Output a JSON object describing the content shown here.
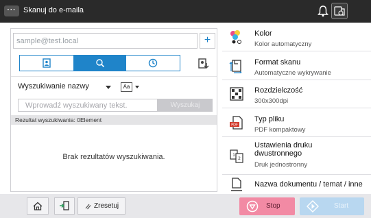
{
  "header": {
    "menu_label": "···",
    "title": "Skanuj do e-maila"
  },
  "address": {
    "placeholder": "sample@test.local"
  },
  "search": {
    "type_label": "Wyszukiwanie nazwy",
    "case_label": "Aa",
    "input_placeholder": "Wprowadź wyszukiwany tekst.",
    "button_label": "Wyszukaj",
    "result_label": "Rezultat wyszukiwania: 0Element",
    "empty_label": "Brak rezultatów wyszukiwania."
  },
  "settings": [
    {
      "title": "Kolor",
      "value": "Kolor automatyczny",
      "icon": "color-icon"
    },
    {
      "title": "Format skanu",
      "value": "Automatyczne wykrywanie",
      "icon": "scan-format-icon"
    },
    {
      "title": "Rozdzielczość",
      "value": "300x300dpi",
      "icon": "resolution-icon"
    },
    {
      "title": "Typ pliku",
      "value": "PDF kompaktowy",
      "icon": "pdf-file-icon"
    },
    {
      "title_line1": "Ustawienia druku",
      "title_line2": "dwustronnego",
      "value": "Druk jednostronny",
      "icon": "duplex-icon"
    },
    {
      "title": "Nazwa dokumentu / temat / inne",
      "icon": "document-name-icon"
    }
  ],
  "footer": {
    "reset_label": "Zresetuj",
    "stop_label": "Stop",
    "start_label": "Start"
  },
  "colors": {
    "accent": "#1f84c9",
    "stop": "#f28aa4",
    "start": "#b8d7f0",
    "topbar": "#2a2a2a"
  }
}
